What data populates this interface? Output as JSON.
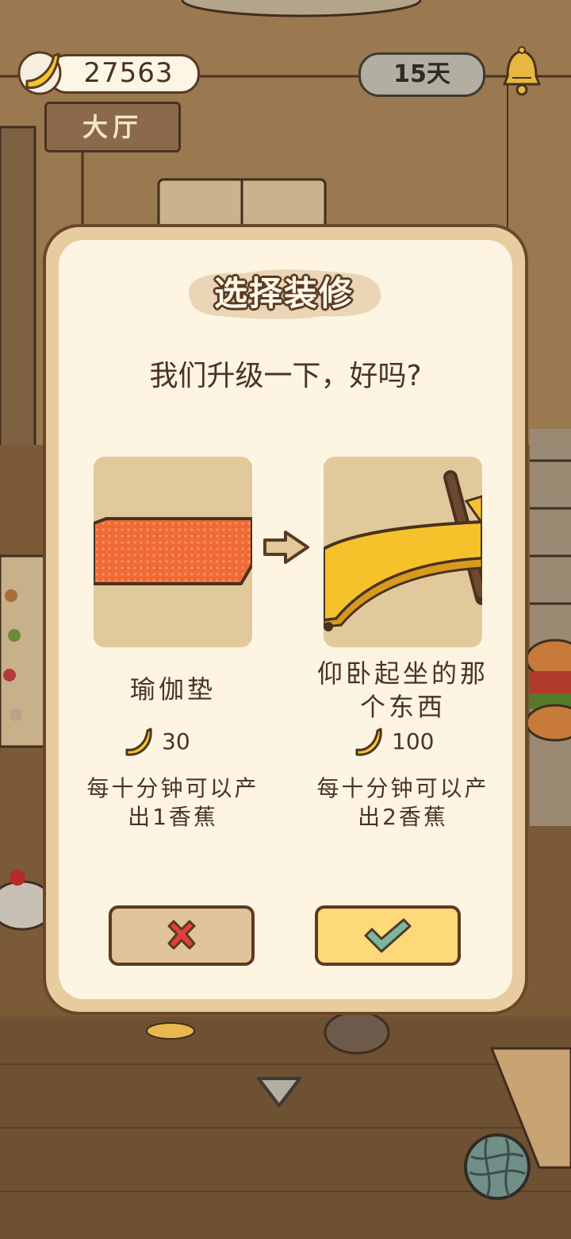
{
  "hud": {
    "banana_count": "27563",
    "banana_icon": "banana-coin-icon",
    "days": "15天",
    "bell_icon": "bell-icon",
    "room_sign": "大厅"
  },
  "dialog": {
    "title": "选择装修",
    "question": "我们升级一下，好吗?",
    "current": {
      "name": "瑜伽垫",
      "price": "30",
      "desc_line1": "每十分钟可以产",
      "desc_line2": "出1香蕉"
    },
    "upgrade": {
      "name_line1": "仰卧起坐的那",
      "name_line2": "个东西",
      "price": "100",
      "desc_line1": "每十分钟可以产",
      "desc_line2": "出2香蕉"
    },
    "arrow_icon": "arrow-right-icon",
    "cancel_icon": "red-x-icon",
    "confirm_icon": "green-check-icon"
  },
  "nav": {
    "down_icon": "chevron-down-icon",
    "yarn_icon": "yarn-ball-icon"
  },
  "colors": {
    "dialog_bg": "#fdf4e2",
    "dialog_frame": "#e6cc9e",
    "confirm_button": "#fdd979",
    "cancel_button": "#e0c39a",
    "text": "#4a3426"
  }
}
